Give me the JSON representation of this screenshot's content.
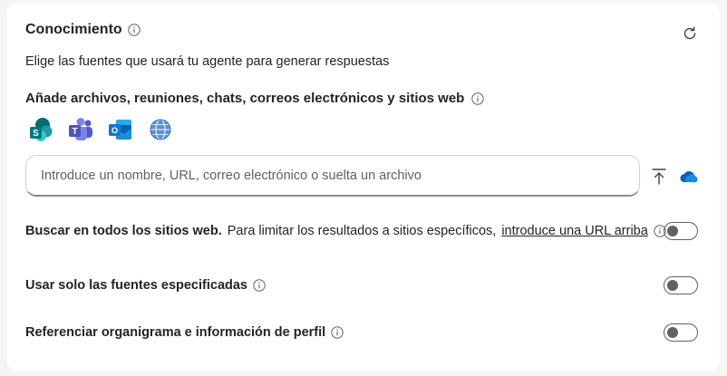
{
  "card": {
    "title": "Conocimiento",
    "subtitle": "Elige las fuentes que usará tu agente para generar respuestas"
  },
  "sources": {
    "heading": "Añade archivos, reuniones, chats, correos electrónicos y sitios web",
    "icons": [
      "sharepoint-icon",
      "teams-icon",
      "outlook-icon",
      "web-globe-icon"
    ]
  },
  "search": {
    "placeholder": "Introduce un nombre, URL, correo electrónico o suelta un archivo",
    "value": ""
  },
  "options": [
    {
      "bold": "Buscar en todos los sitios web.",
      "text": "Para limitar los resultados a sitios específicos,",
      "link": "introduce una URL arriba",
      "enabled": false
    },
    {
      "bold": "Usar solo las fuentes especificadas",
      "enabled": false
    },
    {
      "bold": "Referenciar organigrama e información de perfil",
      "enabled": false
    }
  ],
  "colors": {
    "toggle_off": "#616161",
    "onedrive": "#0364b8",
    "teams": "#5b5fc7",
    "sharepoint": "#036c70"
  }
}
